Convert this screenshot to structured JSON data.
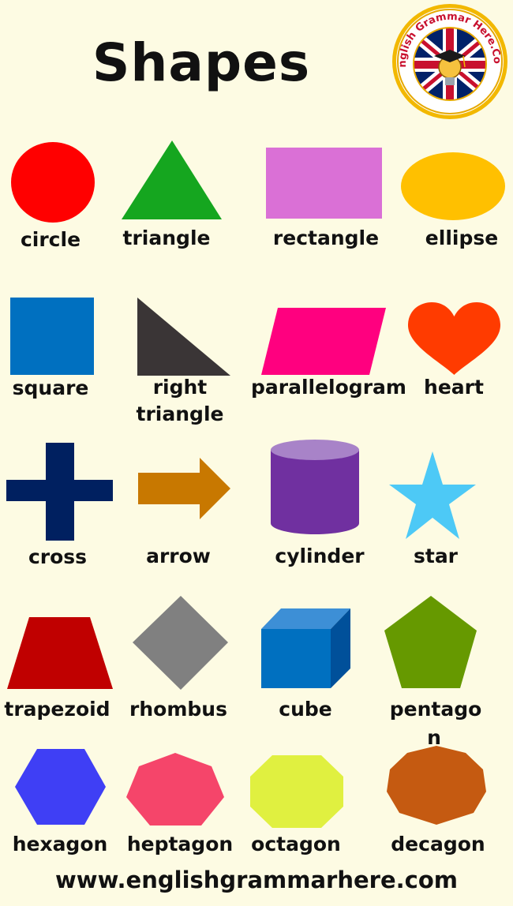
{
  "header": {
    "title": "Shapes",
    "logo_text": "English Grammar Here.Com"
  },
  "shapes": [
    {
      "name": "circle",
      "color": "#ff0000"
    },
    {
      "name": "triangle",
      "color": "#15a61f"
    },
    {
      "name": "rectangle",
      "color": "#da70d6"
    },
    {
      "name": "ellipse",
      "color": "#ffc000"
    },
    {
      "name": "square",
      "color": "#0070c0"
    },
    {
      "name_line1": "right",
      "name_line2": "triangle",
      "color": "#3a3536"
    },
    {
      "name": "parallelogram",
      "color": "#ff007f"
    },
    {
      "name": "heart",
      "color": "#ff3b00"
    },
    {
      "name": "cross",
      "color": "#002060"
    },
    {
      "name": "arrow",
      "color": "#c87800"
    },
    {
      "name": "cylinder",
      "color": "#7030a0"
    },
    {
      "name": "star",
      "color": "#4dc9f6"
    },
    {
      "name": "trapezoid",
      "color": "#c00000"
    },
    {
      "name": "rhombus",
      "color": "#808080"
    },
    {
      "name": "cube",
      "color": "#0070c0"
    },
    {
      "name_line1": "pentago",
      "name_line2": "n",
      "color": "#669900"
    },
    {
      "name": "hexagon",
      "color": "#3f3ff5"
    },
    {
      "name": "heptagon",
      "color": "#f5456a"
    },
    {
      "name": "octagon",
      "color": "#e0f040"
    },
    {
      "name": "decagon",
      "color": "#c55a11"
    }
  ],
  "footer": {
    "url": "www.englishgrammarhere.com"
  }
}
